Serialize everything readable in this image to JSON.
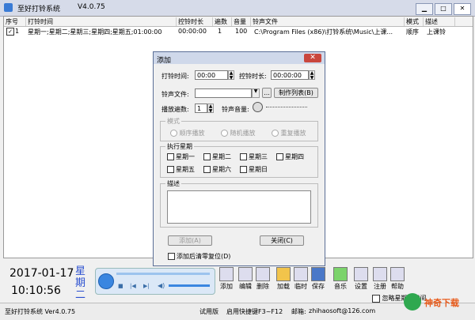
{
  "window": {
    "title": "至好打铃系统",
    "version": "V4.0.75"
  },
  "table": {
    "headers": [
      "序号",
      "打铃时间",
      "控铃时长",
      "遍数",
      "音量",
      "铃声文件",
      "模式",
      "描述"
    ],
    "rows": [
      {
        "index": "1",
        "time": "星期一;星期二;星期三;星期四;星期五;01:00:00",
        "duration": "00:00:00",
        "times": "1",
        "volume": "100",
        "file": "C:\\Program Files (x86)\\打铃系统\\Music\\上课...",
        "mode": "顺序",
        "desc": "上课铃"
      }
    ]
  },
  "clock": {
    "date": "2017-01-17",
    "time": "10:10:56",
    "weekday": "星期二"
  },
  "toolbar": {
    "add": "添加",
    "edit": "编辑",
    "delete": "删除",
    "load": "加载",
    "temp": "临时",
    "save": "保存",
    "music": "音乐",
    "settings": "设置",
    "register": "注册",
    "help": "帮助"
  },
  "statusbar": {
    "name": "至好打铃系统 Ver4.0.75",
    "trial": "试用版",
    "hotkey": "启用快捷键F3~F12",
    "email_label": "邮箱:",
    "email": "zhihaosoft@126.com",
    "checkbox": "忽略星期和时间"
  },
  "dialog": {
    "title": "添加",
    "ring_time_label": "打铃时间:",
    "ring_time": "00:00",
    "duration_label": "控铃时长:",
    "duration": "00:00:00",
    "file_label": "铃声文件:",
    "file_value": "",
    "browse": "...",
    "playlist_button": "制作列表(B)",
    "repeat_label": "播放遍数:",
    "repeat_value": "1",
    "volume_label": "铃声音量:",
    "mode_group": "模式",
    "mode_sequential": "顺序播放",
    "mode_random": "随机播放",
    "mode_repeat": "重复播放",
    "week_group": "执行星期",
    "days": [
      "星期一",
      "星期二",
      "星期三",
      "星期四",
      "星期五",
      "星期六",
      "星期日"
    ],
    "desc_group": "描述",
    "add_button": "添加(A)",
    "close_button": "关闭(C)",
    "reset_checkbox": "添加后清零复位(D)"
  },
  "watermark": "神奇下载",
  "colors": {
    "accent": "#3a86e0",
    "weekday": "#2a4fd0"
  }
}
